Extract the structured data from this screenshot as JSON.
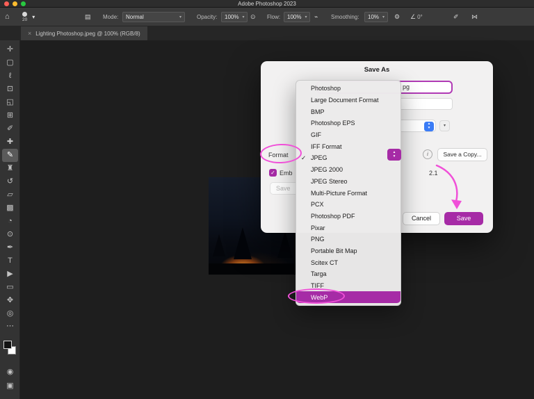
{
  "titlebar": {
    "title": "Adobe Photoshop 2023"
  },
  "options_bar": {
    "home_icon": "⌂",
    "brush_size": "20",
    "panel_icon": "▤",
    "mode_label": "Mode:",
    "mode_value": "Normal",
    "opacity_label": "Opacity:",
    "opacity_value": "100%",
    "pressure_icon": "⊙",
    "flow_label": "Flow:",
    "flow_value": "100%",
    "airbrush_icon": "⌁",
    "smoothing_label": "Smoothing:",
    "smoothing_value": "10%",
    "gear_icon": "⚙",
    "angle_icon": "∠",
    "angle_value": "0°",
    "pen_pressure_icon": "✐",
    "symmetry_icon": "⋈",
    "chevron": "▾"
  },
  "tab": {
    "close": "×",
    "title": "Lighting Photoshop.jpeg @ 100% (RGB/8)"
  },
  "tools": [
    {
      "name": "move-tool",
      "glyph": "✛"
    },
    {
      "name": "marquee-tool",
      "glyph": "▢"
    },
    {
      "name": "lasso-tool",
      "glyph": "ℓ"
    },
    {
      "name": "object-selection-tool",
      "glyph": "⊡"
    },
    {
      "name": "crop-tool",
      "glyph": "◱"
    },
    {
      "name": "frame-tool",
      "glyph": "⊞"
    },
    {
      "name": "eyedropper-tool",
      "glyph": "✐"
    },
    {
      "name": "healing-brush-tool",
      "glyph": "✚"
    },
    {
      "name": "brush-tool",
      "glyph": "✎",
      "selected": true
    },
    {
      "name": "clone-stamp-tool",
      "glyph": "♜"
    },
    {
      "name": "history-brush-tool",
      "glyph": "↺"
    },
    {
      "name": "eraser-tool",
      "glyph": "▱"
    },
    {
      "name": "gradient-tool",
      "glyph": "▩"
    },
    {
      "name": "blur-tool",
      "glyph": "◔"
    },
    {
      "name": "dodge-tool",
      "glyph": "⊙"
    },
    {
      "name": "pen-tool",
      "glyph": "✒"
    },
    {
      "name": "type-tool",
      "glyph": "T"
    },
    {
      "name": "path-selection-tool",
      "glyph": "▶"
    },
    {
      "name": "rectangle-tool",
      "glyph": "▭"
    },
    {
      "name": "hand-tool",
      "glyph": "✥"
    },
    {
      "name": "zoom-tool",
      "glyph": "◎"
    }
  ],
  "tool_extras": {
    "more_icon": "⋯",
    "quick_mask_icon": "◉",
    "screen_mode_icon": "▣"
  },
  "dialog": {
    "title": "Save As",
    "filename_visible": "pg",
    "format_label": "Format",
    "info_glyph": "i",
    "save_a_copy_label": "Save a Copy...",
    "check_glyph": "✓",
    "embed_label_visible": "Emb",
    "profile_visible": "2.1",
    "save_options_visible": "Save",
    "cancel_label": "Cancel",
    "save_label": "Save",
    "stepper_up": "▴",
    "stepper_down": "▾"
  },
  "format_menu": {
    "selected": "JPEG",
    "highlighted": "WebP",
    "items": [
      "Photoshop",
      "Large Document Format",
      "BMP",
      "Photoshop EPS",
      "GIF",
      "IFF Format",
      "JPEG",
      "JPEG 2000",
      "JPEG Stereo",
      "Multi-Picture Format",
      "PCX",
      "Photoshop PDF",
      "Pixar",
      "PNG",
      "Portable Bit Map",
      "Scitex CT",
      "Targa",
      "TIFF",
      "WebP"
    ]
  },
  "colors": {
    "accent": "#a62ba6",
    "annotation": "#f050d8",
    "selection_blue": "#3b7cf6",
    "traffic_red": "#ff5f57",
    "traffic_yellow": "#febc2e",
    "traffic_green": "#28c840"
  }
}
